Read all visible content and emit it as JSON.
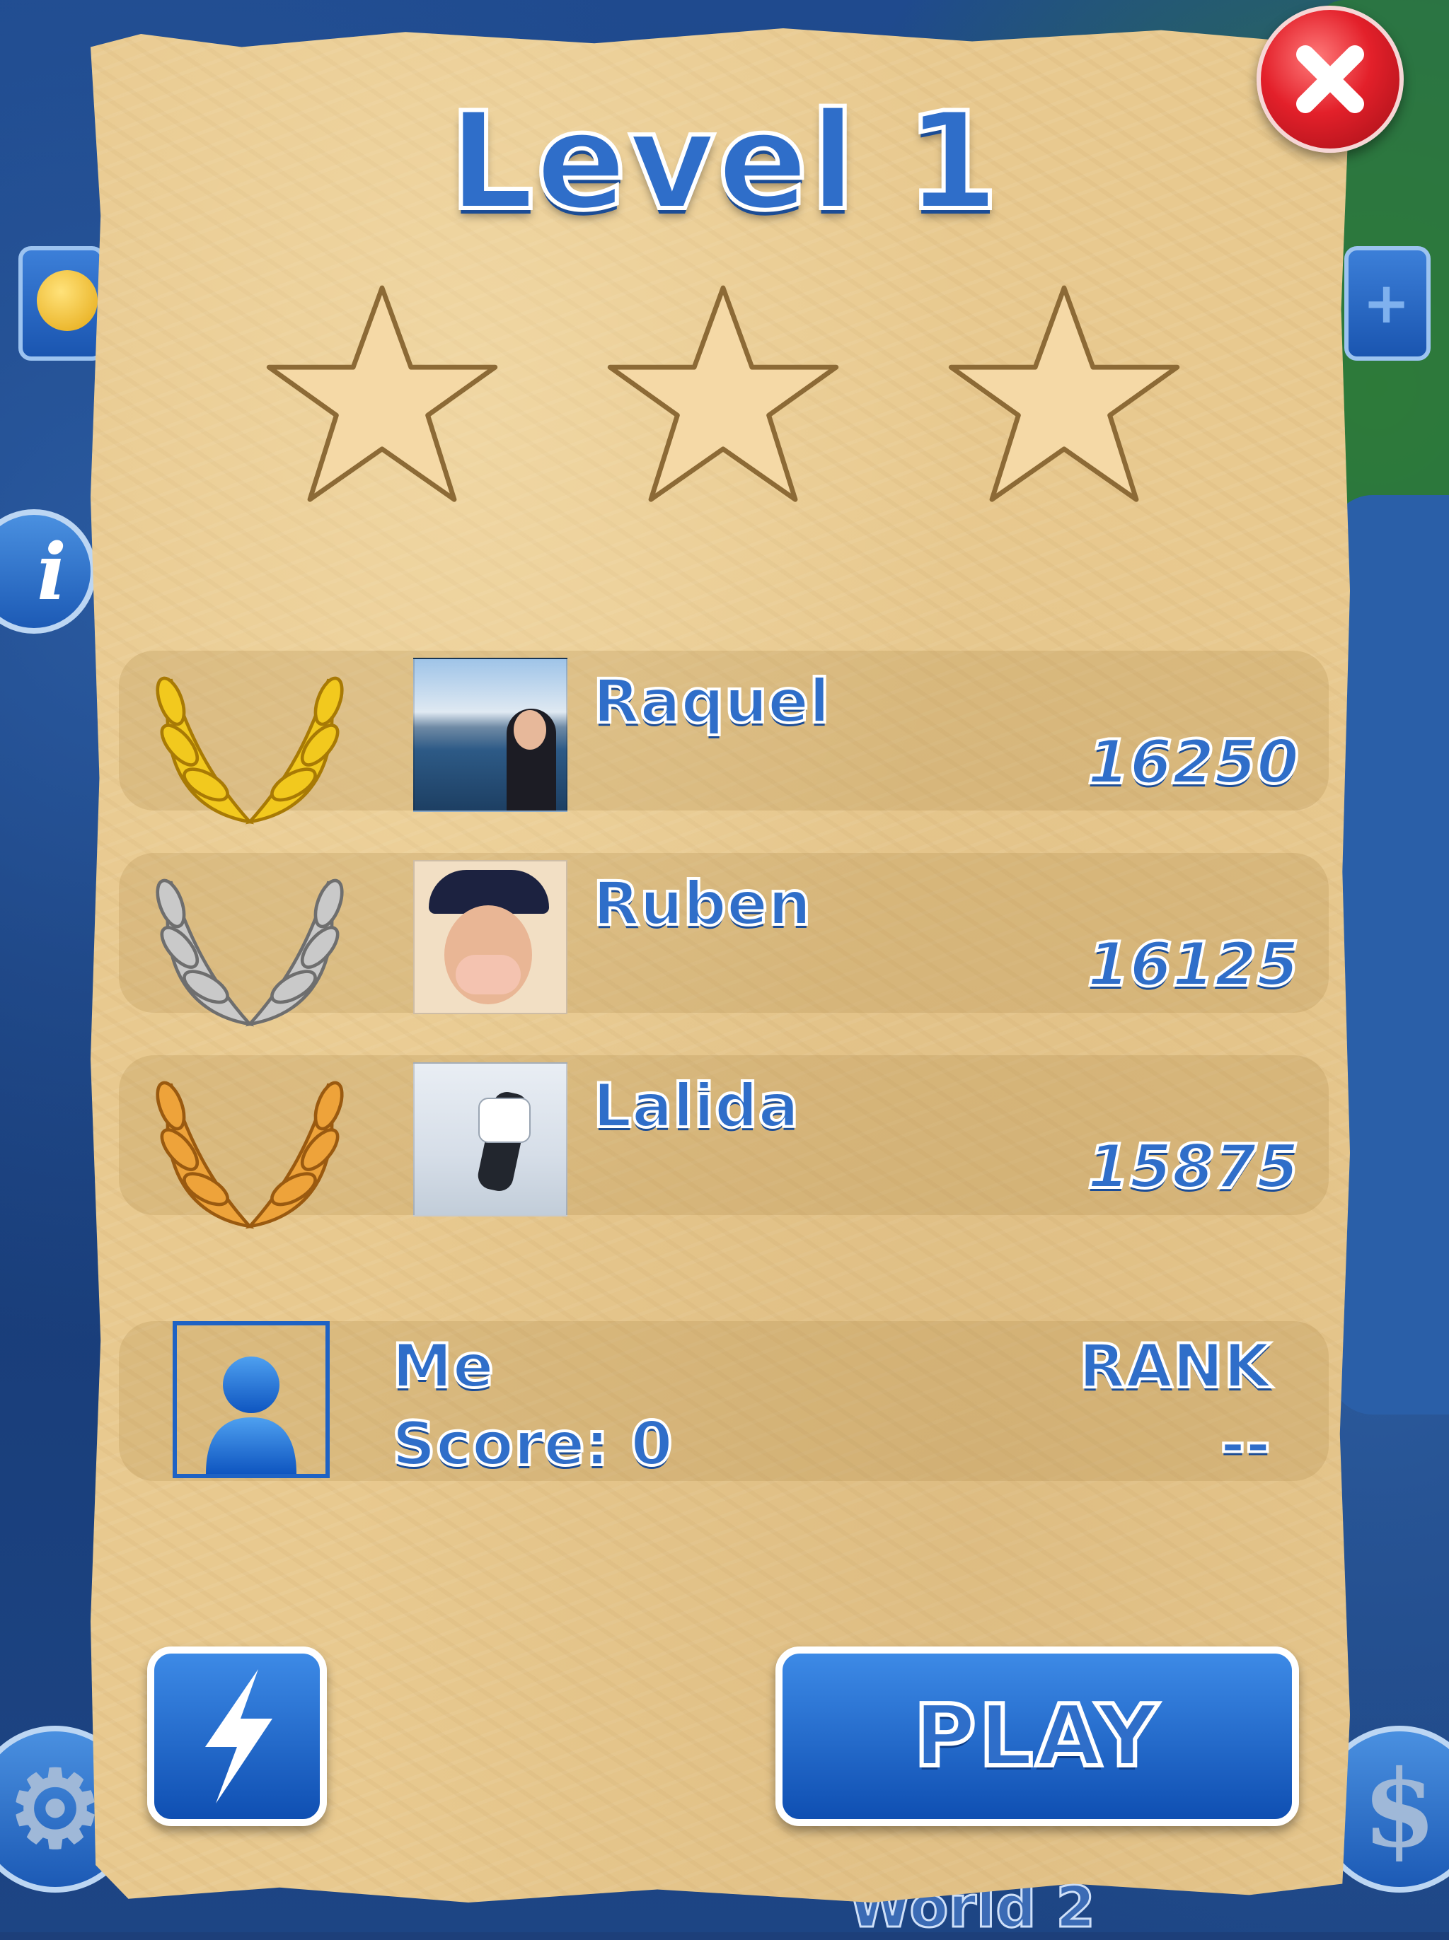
{
  "level": {
    "title": "Level 1"
  },
  "stars": {
    "earned": 0,
    "total": 3
  },
  "leaderboard": [
    {
      "rank_medal": "gold-laurel",
      "name": "Raquel",
      "score": "16250"
    },
    {
      "rank_medal": "silver-laurel",
      "name": "Ruben",
      "score": "16125"
    },
    {
      "rank_medal": "bronze-laurel",
      "name": "Lalida",
      "score": "15875"
    }
  ],
  "me": {
    "name": "Me",
    "score_text": "Score: 0",
    "rank_label": "RANK",
    "rank_value": "--"
  },
  "buttons": {
    "play_label": "PLAY",
    "boost_icon": "lightning-icon",
    "close_icon": "close-icon"
  },
  "background": {
    "world_label": "World 2"
  },
  "colors": {
    "accent": "#2f6ec9",
    "close": "#e3202a",
    "parchment": "#e8c98f"
  }
}
